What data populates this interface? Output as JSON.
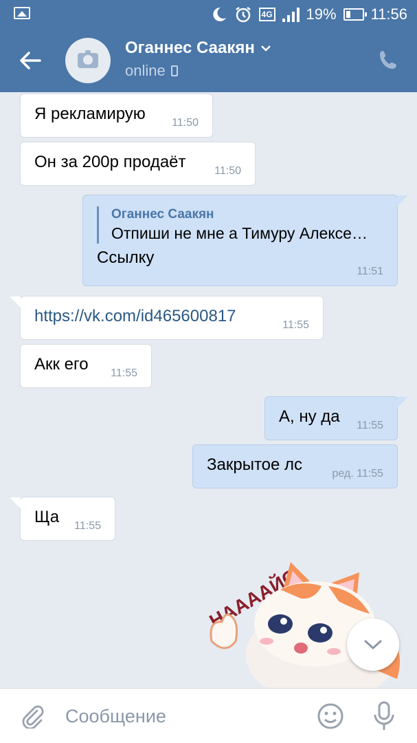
{
  "status_bar": {
    "network": "4G",
    "battery": "19%",
    "time": "11:56",
    "icons": [
      "image-icon",
      "moon-icon",
      "alarm-icon",
      "signal-icon",
      "battery-charging-icon"
    ]
  },
  "header": {
    "contact_name": "Оганнес Саакян",
    "status": "online",
    "icons": [
      "back-arrow-icon",
      "camera-icon",
      "chevron-down-icon",
      "mobile-icon",
      "phone-icon"
    ]
  },
  "messages": [
    {
      "dir": "in",
      "text": "Я рекламирую",
      "time": "11:50"
    },
    {
      "dir": "in",
      "text": "Он за 200р продаёт",
      "time": "11:50"
    },
    {
      "dir": "out",
      "reply_name": "Оганнес Саакян",
      "reply_text": "Отпиши не мне а Тимуру Алексе…",
      "text": "Ссылку",
      "time": "11:51"
    },
    {
      "dir": "in",
      "text": "https://vk.com/id465600817",
      "time": "11:55",
      "is_link": true
    },
    {
      "dir": "in",
      "text": "Акк его",
      "time": "11:55"
    },
    {
      "dir": "out",
      "text": "А, ну да",
      "time": "11:55"
    },
    {
      "dir": "out",
      "text": "Закрытое лс",
      "time": "ред. 11:55"
    },
    {
      "dir": "in",
      "text": "Ща",
      "time": "11:55"
    }
  ],
  "sticker": {
    "text": "НААААЙС"
  },
  "input": {
    "placeholder": "Сообщение",
    "icons": [
      "attach-icon",
      "smile-icon",
      "mic-icon",
      "chevron-down-icon"
    ]
  },
  "colors": {
    "header": "#4a76a8",
    "background": "#e6ebf1",
    "outgoing": "#cfe1f7",
    "incoming": "#ffffff",
    "link": "#2a5885"
  }
}
